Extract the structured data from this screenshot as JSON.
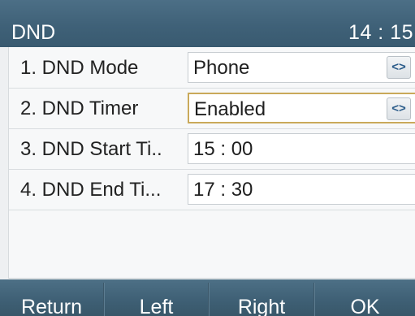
{
  "header": {
    "title": "DND",
    "time": "14 : 15"
  },
  "rows": [
    {
      "label": "1. DND Mode",
      "value": "Phone",
      "has_switch": true,
      "switch_icon": "<>"
    },
    {
      "label": "2. DND Timer",
      "value": "Enabled",
      "has_switch": true,
      "switch_icon": "<>",
      "selected": true
    },
    {
      "label": "3. DND Start Ti..",
      "value": "15 : 00",
      "has_switch": false
    },
    {
      "label": "4. DND End Ti...",
      "value": "17 : 30",
      "has_switch": false
    }
  ],
  "softkeys": [
    "Return",
    "Left",
    "Right",
    "OK"
  ],
  "colors": {
    "title_bar": "#3f6178",
    "softkey_bar": "#3e5f74",
    "selection_border": "#c9a95a",
    "switch_glyph": "#2b5c8a"
  }
}
